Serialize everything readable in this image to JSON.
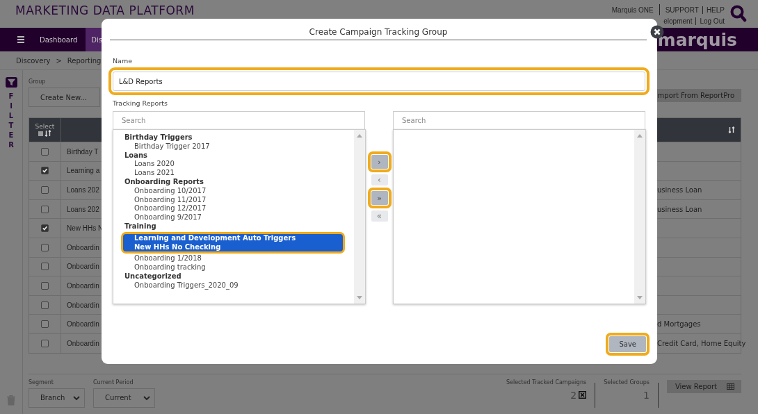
{
  "header": {
    "title": "MARKETING DATA PLATFORM",
    "top_links": [
      "Marquis ONE",
      "SUPPORT",
      "HELP"
    ],
    "bottom_links": [
      "elopment",
      "Log Out"
    ]
  },
  "nav": {
    "items": [
      {
        "label": "Dashboard",
        "selected": false
      },
      {
        "label": "Dis",
        "selected": true
      }
    ],
    "logo": "marquis"
  },
  "breadcrumb": {
    "items": [
      "Discovery",
      "Reporting"
    ],
    "separator": ">"
  },
  "filter": {
    "label": "FILTER"
  },
  "group": {
    "label": "Group",
    "value": "Create New..."
  },
  "import_button": "mport From ReportPro",
  "table": {
    "select_header": "Select",
    "select_all": {
      "checked": false
    },
    "rows": [
      {
        "checked": false,
        "name": "Birthday T"
      },
      {
        "checked": true,
        "name": "Learning a"
      },
      {
        "checked": false,
        "name": "Loans 202",
        "detail": "usiness Loan"
      },
      {
        "checked": false,
        "name": "Loans 202",
        "detail": "usiness Loan"
      },
      {
        "checked": true,
        "name": "New HHs N"
      },
      {
        "checked": false,
        "name": "Onboardin"
      },
      {
        "checked": false,
        "name": "Onboardin"
      },
      {
        "checked": false,
        "name": "Onboardin"
      },
      {
        "checked": false,
        "name": "Onboardin"
      },
      {
        "checked": false,
        "name": "Onboardin",
        "detail": "d Mortgages"
      },
      {
        "checked": false,
        "name": "Onboardin",
        "detail": "Credit Card, Home Equity"
      }
    ]
  },
  "footer": {
    "segment": {
      "label": "Segment",
      "value": "Branch"
    },
    "period": {
      "label": "Current Period",
      "value": "Current"
    },
    "tracked": {
      "label": "Selected Tracked Campaigns",
      "value": "2"
    },
    "groups": {
      "label": "Selected Groups",
      "value": "1"
    },
    "view_button": "View Report"
  },
  "modal": {
    "title": "Create Campaign Tracking Group",
    "name_label": "Name",
    "name_field": {
      "value": "L&D Reports",
      "highlighted": true
    },
    "reports_label": "Tracking Reports",
    "left_search": {
      "placeholder": "Search"
    },
    "right_search": {
      "placeholder": "Search"
    },
    "groups": [
      {
        "label": "Birthday Triggers",
        "items": [
          {
            "label": "Birthday Trigger 2017",
            "selected": false
          }
        ]
      },
      {
        "label": "Loans",
        "items": [
          {
            "label": "Loans 2020",
            "selected": false
          },
          {
            "label": "Loans 2021",
            "selected": false
          }
        ]
      },
      {
        "label": "Onboarding Reports",
        "items": [
          {
            "label": "Onboarding 10/2017",
            "selected": false
          },
          {
            "label": "Onboarding 11/2017",
            "selected": false
          },
          {
            "label": "Onboarding 12/2017",
            "selected": false
          },
          {
            "label": "Onboarding 9/2017",
            "selected": false
          }
        ]
      },
      {
        "label": "Training",
        "items": [
          {
            "label": "Learning and Development Auto Triggers",
            "selected": true
          },
          {
            "label": "New HHs No Checking",
            "selected": true
          },
          {
            "label": "Onboarding 1/2018",
            "selected": false
          },
          {
            "label": "Onboarding tracking",
            "selected": false
          }
        ]
      },
      {
        "label": "Uncategorized",
        "items": [
          {
            "label": "Onboarding Triggers_2020_09",
            "selected": false
          }
        ]
      }
    ],
    "move_buttons": [
      {
        "label": "›",
        "disabled": false,
        "highlighted": true
      },
      {
        "label": "‹",
        "disabled": true,
        "highlighted": false
      },
      {
        "label": "»",
        "disabled": false,
        "highlighted": true
      },
      {
        "label": "«",
        "disabled": true,
        "highlighted": false
      }
    ],
    "save": {
      "label": "Save",
      "highlighted": true
    }
  }
}
